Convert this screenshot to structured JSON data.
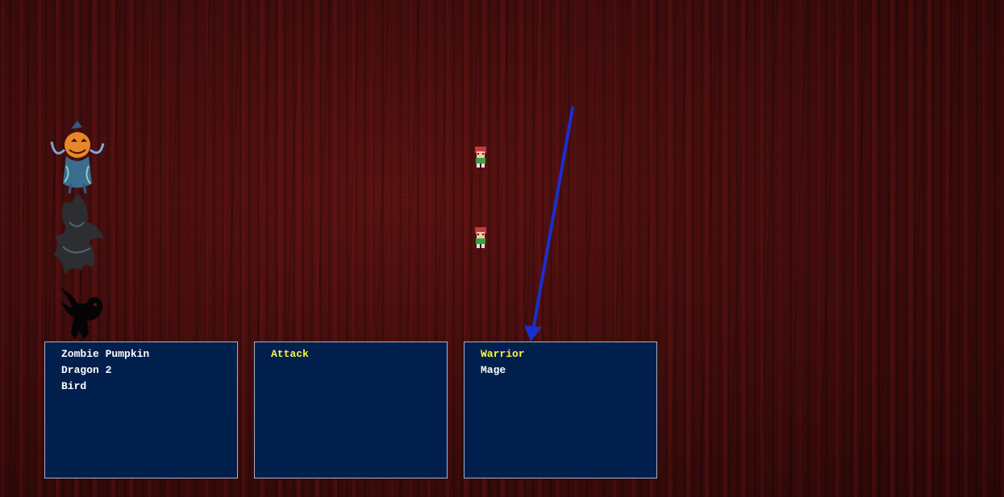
{
  "enemy_window": {
    "items": [
      "Zombie Pumpkin",
      "Dragon 2",
      "Bird"
    ]
  },
  "command_window": {
    "items": [
      "Attack"
    ],
    "selected_index": 0
  },
  "party_window": {
    "items": [
      "Warrior",
      "Mage"
    ],
    "selected_index": 0
  },
  "colors": {
    "background": "#3a0b0b",
    "window_bg": "#001f4d",
    "window_border": "#a9b3c4",
    "text": "#ffffff",
    "highlight": "#f5f545",
    "annotation_arrow": "#1a2fd0"
  },
  "icons": {
    "enemies": [
      "zombie-pumpkin-sprite",
      "dragon-sprite",
      "bird-sprite"
    ],
    "party": [
      "warrior-sprite",
      "mage-sprite"
    ],
    "annotation": "arrow-annotation-icon"
  }
}
